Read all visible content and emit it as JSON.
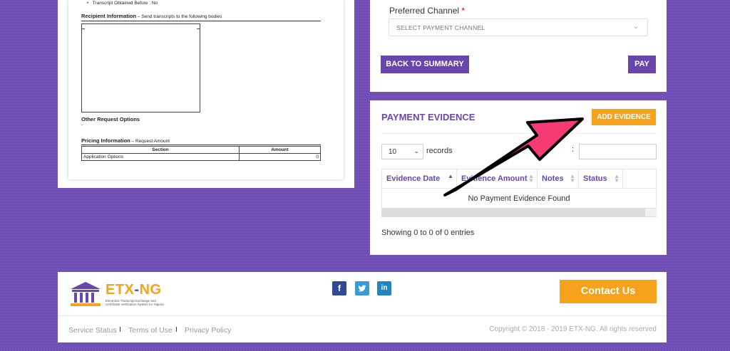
{
  "document_preview": {
    "bullet": "Transcript Obtained Before : No",
    "recipient_heading": "Recipient Information",
    "recipient_sub": " – Send transcripts to the following bodies",
    "other_heading": "Other Request Options",
    "other_value": "-",
    "pricing_heading": "Pricing Information",
    "pricing_sub": " – Request Amount",
    "pricing_columns": [
      "Section",
      "Amount"
    ],
    "pricing_rows": [
      [
        "Application Options",
        "0"
      ]
    ]
  },
  "payment_form": {
    "channel_label": "Preferred Channel",
    "required_mark": "*",
    "channel_placeholder": "SELECT PAYMENT CHANNEL",
    "back_button": "BACK TO SUMMARY",
    "pay_button": "PAY"
  },
  "evidence": {
    "title": "PAYMENT EVIDENCE",
    "add_button": "ADD EVIDENCE",
    "page_size": "10",
    "records_label": "records",
    "search_colon": ":",
    "columns": [
      "Evidence Date",
      "Evidence Amount",
      "Notes",
      "Status"
    ],
    "empty_message": "No Payment Evidence Found",
    "info": "Showing 0 to 0 of 0 entries"
  },
  "footer": {
    "logo_name": "ETX",
    "logo_dash": "-",
    "logo_suffix": "NG",
    "logo_tagline": "Electronic Transcript Exchange and Certificate Verification System for Nigeria",
    "social": [
      "facebook-icon",
      "twitter-icon",
      "linkedin-icon"
    ],
    "contact_button": "Contact Us",
    "links": [
      "Service Status",
      "Terms of Use",
      "Privacy Policy"
    ],
    "separator": "I",
    "copyright": "Copyright © 2018 - 2019 ETX-NG. All rights reserved"
  },
  "colors": {
    "background": "#6f4fb6",
    "brand_purple": "#6946ab",
    "accent_orange": "#f7a21b",
    "arrow": "#f43b72"
  }
}
